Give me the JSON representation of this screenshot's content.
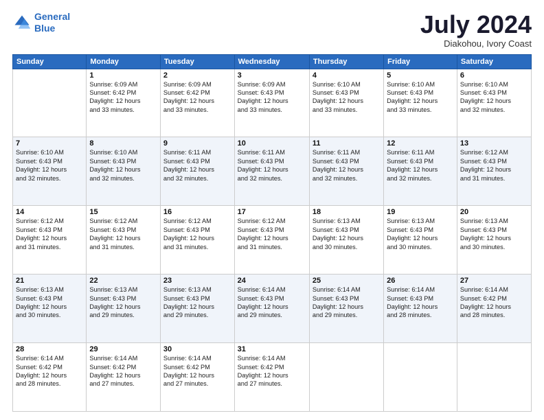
{
  "header": {
    "logo_line1": "General",
    "logo_line2": "Blue",
    "month": "July 2024",
    "location": "Diakohou, Ivory Coast"
  },
  "columns": [
    "Sunday",
    "Monday",
    "Tuesday",
    "Wednesday",
    "Thursday",
    "Friday",
    "Saturday"
  ],
  "weeks": [
    {
      "days": [
        {
          "num": "",
          "info": ""
        },
        {
          "num": "1",
          "info": "Sunrise: 6:09 AM\nSunset: 6:42 PM\nDaylight: 12 hours\nand 33 minutes."
        },
        {
          "num": "2",
          "info": "Sunrise: 6:09 AM\nSunset: 6:42 PM\nDaylight: 12 hours\nand 33 minutes."
        },
        {
          "num": "3",
          "info": "Sunrise: 6:09 AM\nSunset: 6:43 PM\nDaylight: 12 hours\nand 33 minutes."
        },
        {
          "num": "4",
          "info": "Sunrise: 6:10 AM\nSunset: 6:43 PM\nDaylight: 12 hours\nand 33 minutes."
        },
        {
          "num": "5",
          "info": "Sunrise: 6:10 AM\nSunset: 6:43 PM\nDaylight: 12 hours\nand 33 minutes."
        },
        {
          "num": "6",
          "info": "Sunrise: 6:10 AM\nSunset: 6:43 PM\nDaylight: 12 hours\nand 32 minutes."
        }
      ]
    },
    {
      "days": [
        {
          "num": "7",
          "info": "Sunrise: 6:10 AM\nSunset: 6:43 PM\nDaylight: 12 hours\nand 32 minutes."
        },
        {
          "num": "8",
          "info": "Sunrise: 6:10 AM\nSunset: 6:43 PM\nDaylight: 12 hours\nand 32 minutes."
        },
        {
          "num": "9",
          "info": "Sunrise: 6:11 AM\nSunset: 6:43 PM\nDaylight: 12 hours\nand 32 minutes."
        },
        {
          "num": "10",
          "info": "Sunrise: 6:11 AM\nSunset: 6:43 PM\nDaylight: 12 hours\nand 32 minutes."
        },
        {
          "num": "11",
          "info": "Sunrise: 6:11 AM\nSunset: 6:43 PM\nDaylight: 12 hours\nand 32 minutes."
        },
        {
          "num": "12",
          "info": "Sunrise: 6:11 AM\nSunset: 6:43 PM\nDaylight: 12 hours\nand 32 minutes."
        },
        {
          "num": "13",
          "info": "Sunrise: 6:12 AM\nSunset: 6:43 PM\nDaylight: 12 hours\nand 31 minutes."
        }
      ]
    },
    {
      "days": [
        {
          "num": "14",
          "info": "Sunrise: 6:12 AM\nSunset: 6:43 PM\nDaylight: 12 hours\nand 31 minutes."
        },
        {
          "num": "15",
          "info": "Sunrise: 6:12 AM\nSunset: 6:43 PM\nDaylight: 12 hours\nand 31 minutes."
        },
        {
          "num": "16",
          "info": "Sunrise: 6:12 AM\nSunset: 6:43 PM\nDaylight: 12 hours\nand 31 minutes."
        },
        {
          "num": "17",
          "info": "Sunrise: 6:12 AM\nSunset: 6:43 PM\nDaylight: 12 hours\nand 31 minutes."
        },
        {
          "num": "18",
          "info": "Sunrise: 6:13 AM\nSunset: 6:43 PM\nDaylight: 12 hours\nand 30 minutes."
        },
        {
          "num": "19",
          "info": "Sunrise: 6:13 AM\nSunset: 6:43 PM\nDaylight: 12 hours\nand 30 minutes."
        },
        {
          "num": "20",
          "info": "Sunrise: 6:13 AM\nSunset: 6:43 PM\nDaylight: 12 hours\nand 30 minutes."
        }
      ]
    },
    {
      "days": [
        {
          "num": "21",
          "info": "Sunrise: 6:13 AM\nSunset: 6:43 PM\nDaylight: 12 hours\nand 30 minutes."
        },
        {
          "num": "22",
          "info": "Sunrise: 6:13 AM\nSunset: 6:43 PM\nDaylight: 12 hours\nand 29 minutes."
        },
        {
          "num": "23",
          "info": "Sunrise: 6:13 AM\nSunset: 6:43 PM\nDaylight: 12 hours\nand 29 minutes."
        },
        {
          "num": "24",
          "info": "Sunrise: 6:14 AM\nSunset: 6:43 PM\nDaylight: 12 hours\nand 29 minutes."
        },
        {
          "num": "25",
          "info": "Sunrise: 6:14 AM\nSunset: 6:43 PM\nDaylight: 12 hours\nand 29 minutes."
        },
        {
          "num": "26",
          "info": "Sunrise: 6:14 AM\nSunset: 6:43 PM\nDaylight: 12 hours\nand 28 minutes."
        },
        {
          "num": "27",
          "info": "Sunrise: 6:14 AM\nSunset: 6:42 PM\nDaylight: 12 hours\nand 28 minutes."
        }
      ]
    },
    {
      "days": [
        {
          "num": "28",
          "info": "Sunrise: 6:14 AM\nSunset: 6:42 PM\nDaylight: 12 hours\nand 28 minutes."
        },
        {
          "num": "29",
          "info": "Sunrise: 6:14 AM\nSunset: 6:42 PM\nDaylight: 12 hours\nand 27 minutes."
        },
        {
          "num": "30",
          "info": "Sunrise: 6:14 AM\nSunset: 6:42 PM\nDaylight: 12 hours\nand 27 minutes."
        },
        {
          "num": "31",
          "info": "Sunrise: 6:14 AM\nSunset: 6:42 PM\nDaylight: 12 hours\nand 27 minutes."
        },
        {
          "num": "",
          "info": ""
        },
        {
          "num": "",
          "info": ""
        },
        {
          "num": "",
          "info": ""
        }
      ]
    }
  ]
}
